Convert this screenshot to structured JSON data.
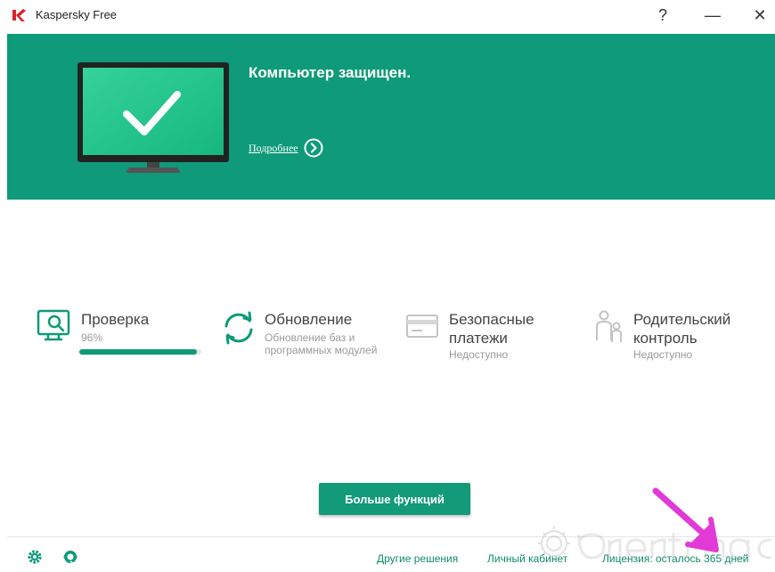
{
  "window": {
    "title": "Kaspersky Free",
    "help_label": "?",
    "minimize_label": "—",
    "close_label": "✕"
  },
  "hero": {
    "status_title": "Компьютер защищен.",
    "details_link": "Подробнее"
  },
  "features": {
    "scan": {
      "title": "Проверка",
      "progress_text": "96%",
      "progress_value": 0.96
    },
    "update": {
      "title": "Обновление",
      "subtitle": "Обновление баз и программных модулей"
    },
    "payments": {
      "title": "Безопасные платежи",
      "status": "Недоступно"
    },
    "parental": {
      "title": "Родительский контроль",
      "status": "Недоступно"
    }
  },
  "more_button": {
    "label": "Больше функций"
  },
  "footer": {
    "other_solutions": "Другие решения",
    "my_account": "Личный кабинет",
    "license": "Лицензия: осталось 365 дней"
  },
  "colors": {
    "brand_green": "#0f9a7a",
    "link_green": "#0f8a6d",
    "annotation_arrow": "#e23ad6"
  },
  "icons": [
    "kaspersky-logo",
    "monitor-check-icon",
    "chevron-right-circle-icon",
    "scan-monitor-icon",
    "update-icon",
    "card-icon",
    "family-icon",
    "gear-icon",
    "support-icon"
  ]
}
